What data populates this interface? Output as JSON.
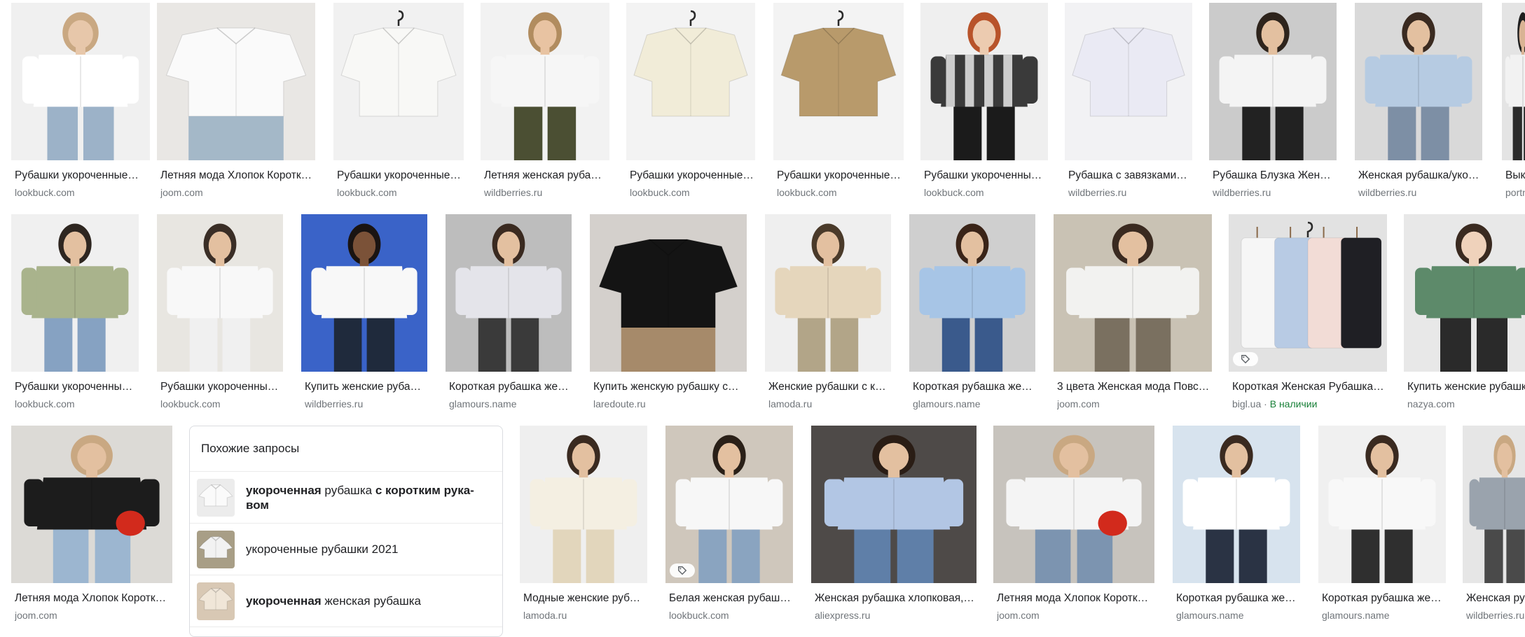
{
  "rows": [
    [
      {
        "title": "Рубашки укороченные…",
        "source": "lookbuck.com",
        "scene": {
          "bg": "#f0f0f0",
          "figure": true,
          "shirt": "#ffffff",
          "pants": "#9cb2c8",
          "hair": "#c9a882",
          "skin": "#e7c7aa"
        }
      },
      {
        "title": "Летняя мода Хлопок Короткий…",
        "source": "joom.com",
        "scene": {
          "bg": "#e9e7e4",
          "figure": false,
          "shirt": "#fafafa",
          "pants": "#a4b8c8",
          "skin": "#e0b898"
        }
      },
      {
        "title": "Рубашки укороченные…",
        "source": "lookbuck.com",
        "scene": {
          "bg": "#f1f1f1",
          "figure": false,
          "shirt": "#f8f8f6",
          "hanger": true
        }
      },
      {
        "title": "Летняя женская рубашка…",
        "source": "wildberries.ru",
        "scene": {
          "bg": "#f2f2f2",
          "figure": true,
          "shirt": "#f6f6f6",
          "pants": "#4b4f33",
          "hair": "#b18c5f",
          "skin": "#e8c3a2"
        }
      },
      {
        "title": "Рубашки укороченные…",
        "source": "lookbuck.com",
        "scene": {
          "bg": "#f3f3f3",
          "figure": false,
          "shirt": "#f1ecd8",
          "hanger": true
        }
      },
      {
        "title": "Рубашки укороченные…",
        "source": "lookbuck.com",
        "scene": {
          "bg": "#f3f3f3",
          "figure": false,
          "shirt": "#b89a6b",
          "hanger": true
        }
      },
      {
        "title": "Рубашки укороченные…",
        "source": "lookbuck.com",
        "scene": {
          "bg": "#efefef",
          "figure": true,
          "shirt": "#3a3a3a",
          "shirt2": "#f3f3f3",
          "pants": "#1b1b1b",
          "hair": "#b8532a",
          "skin": "#eccbb0"
        }
      },
      {
        "title": "Рубашка с завязками…",
        "source": "wildberries.ru",
        "scene": {
          "bg": "#f2f2f4",
          "figure": false,
          "shirt": "#eaeaf4"
        }
      },
      {
        "title": "Рубашка Блузка Женская…",
        "source": "wildberries.ru",
        "scene": {
          "bg": "#cbcbcb",
          "figure": true,
          "shirt": "#f4f4f4",
          "pants": "#222222",
          "hair": "#2e241c",
          "skin": "#e3c0a0"
        }
      },
      {
        "title": "Женская рубашка/укороченная…",
        "source": "wildberries.ru",
        "scene": {
          "bg": "#d9d9d9",
          "figure": true,
          "shirt": "#b6cbe2",
          "pants": "#7d8fa5",
          "hair": "#3a2a20",
          "skin": "#e3c0a0"
        }
      },
      {
        "title": "Выкройка…",
        "source": "portnoff.ru",
        "scene": {
          "bg": "#e4e4e4",
          "figure": true,
          "shirt": "#f2f2f2",
          "pants": "#2b2b2b",
          "hair": "#1f1f1f",
          "skin": "#d9b394"
        }
      }
    ],
    [
      {
        "title": "Рубашки укороченные…",
        "source": "lookbuck.com",
        "scene": {
          "bg": "#f0f0f0",
          "figure": true,
          "shirt": "#a9b38c",
          "pants": "#86a2c2",
          "hair": "#2e2620",
          "skin": "#e3c0a0"
        }
      },
      {
        "title": "Рубашки укороченные…",
        "source": "lookbuck.com",
        "scene": {
          "bg": "#e8e6e1",
          "figure": true,
          "shirt": "#f8f8f8",
          "pants": "#f0f0f0",
          "hair": "#3a2e26",
          "skin": "#e3c0a0"
        }
      },
      {
        "title": "Купить женские рубашки…",
        "source": "wildberries.ru",
        "scene": {
          "bg": "#3a63c8",
          "figure": true,
          "shirt": "#f8f8f8",
          "pants": "#1f2a3c",
          "hair": "#1a1412",
          "skin": "#7b5238"
        }
      },
      {
        "title": "Короткая рубашка женская…",
        "source": "glamours.name",
        "scene": {
          "bg": "#bdbdbd",
          "figure": true,
          "shirt": "#e4e4ea",
          "pants": "#3a3a3a",
          "hair": "#3a2a20",
          "skin": "#e3c0a0"
        }
      },
      {
        "title": "Купить женскую рубашку с…",
        "source": "laredoute.ru",
        "scene": {
          "bg": "#d4d0cc",
          "figure": false,
          "shirt": "#141414",
          "pants": "#a68a6a",
          "skin": "#e3c0a0"
        }
      },
      {
        "title": "Женские рубашки с коротким…",
        "source": "lamoda.ru",
        "scene": {
          "bg": "#efefef",
          "figure": true,
          "shirt": "#e5d6bc",
          "pants": "#b2a588",
          "hair": "#4a3a2a",
          "skin": "#e3c0a0"
        }
      },
      {
        "title": "Короткая рубашка женская…",
        "source": "glamours.name",
        "scene": {
          "bg": "#cfcfcf",
          "figure": true,
          "shirt": "#a7c5e6",
          "pants": "#3a5a8c",
          "hair": "#3a2418",
          "skin": "#e3c0a0"
        }
      },
      {
        "title": "3 цвета Женская мода Повседневная…",
        "source": "joom.com",
        "scene": {
          "bg": "#c9c2b4",
          "figure": true,
          "shirt": "#f2f2f0",
          "pants": "#7a7060",
          "hair": "#3a2a20",
          "skin": "#e3c0a0"
        }
      },
      {
        "title": "Короткая Женская Рубашка…",
        "source": "bigl.ua",
        "stock": "В наличии",
        "tag": true,
        "scene": {
          "bg": "#e2e2e2",
          "figure": false,
          "shirt": "#f6f6f6",
          "extra": [
            "#b8cbe4",
            "#f2dcd6",
            "#1f1f24"
          ],
          "hanger": true
        }
      },
      {
        "title": "Купить женские рубашки…",
        "source": "nazya.com",
        "scene": {
          "bg": "#e8e8e8",
          "figure": true,
          "shirt": "#5d8a6a",
          "pants": "#2a2a2a",
          "hair": "#3a2a20",
          "skin": "#efd2bb"
        }
      }
    ],
    [
      {
        "title": "Летняя мода Хлопок Короткий…",
        "source": "joom.com",
        "scene": {
          "bg": "#dcdad6",
          "figure": true,
          "shirt": "#1c1c1c",
          "pants": "#9cb6d0",
          "hair": "#c9a882",
          "skin": "#e3c0a0",
          "bag": "#d22a1c"
        }
      },
      {
        "title": "Модные женские рубашки…",
        "source": "lamoda.ru",
        "scene": {
          "bg": "#efefef",
          "figure": true,
          "shirt": "#f4efe2",
          "pants": "#e2d6bc",
          "hair": "#3a2a20",
          "skin": "#e3c0a0"
        }
      },
      {
        "title": "Белая женская рубашка…",
        "source": "lookbuck.com",
        "tag": true,
        "scene": {
          "bg": "#cfc7bc",
          "figure": true,
          "shirt": "#f7f7f7",
          "pants": "#8aa4c0",
          "hair": "#2a2018",
          "skin": "#e3c0a0"
        }
      },
      {
        "title": "Женская рубашка хлопковая,…",
        "source": "aliexpress.ru",
        "scene": {
          "bg": "#4e4a48",
          "figure": true,
          "shirt": "#b2c6e4",
          "pants": "#5f7fa8",
          "hair": "#2a1d15",
          "skin": "#e3c0a0"
        }
      },
      {
        "title": "Летняя мода Хлопок Короткий…",
        "source": "joom.com",
        "scene": {
          "bg": "#c7c3bd",
          "figure": true,
          "shirt": "#f4f4f4",
          "pants": "#7c94b0",
          "hair": "#c9a882",
          "skin": "#e3c0a0",
          "bag": "#d22a1c"
        }
      },
      {
        "title": "Короткая рубашка женская…",
        "source": "glamours.name",
        "scene": {
          "bg": "#d7e3ee",
          "figure": true,
          "shirt": "#ffffff",
          "pants": "#2a3344",
          "hair": "#3a2a20",
          "skin": "#e3c0a0"
        }
      },
      {
        "title": "Короткая рубашка женская…",
        "source": "glamours.name",
        "scene": {
          "bg": "#f0f0f0",
          "figure": true,
          "shirt": "#f8f8f8",
          "pants": "#2f2f2f",
          "hair": "#3a2a20",
          "skin": "#e3c0a0"
        }
      },
      {
        "title": "Женская рубашка…",
        "source": "wildberries.ru",
        "scene": {
          "bg": "#e6e6e6",
          "figure": true,
          "shirt": "#9aa3ad",
          "pants": "#4a4a4a",
          "hair": "#c9a882",
          "skin": "#e3c0a0"
        }
      }
    ]
  ],
  "related": {
    "heading": "Похожие запросы",
    "items": [
      {
        "parts": [
          [
            "b",
            "укороченная"
          ],
          [
            "n",
            " рубашка "
          ],
          [
            "b",
            "с коротким рука-"
          ]
        ],
        "line2": [
          [
            "b",
            "вом"
          ]
        ],
        "thumb": {
          "bg": "#ececec",
          "shirt": "#fafafa"
        }
      },
      {
        "parts": [
          [
            "n",
            "укороченные рубашки 2021"
          ]
        ],
        "line2": [],
        "thumb": {
          "bg": "#a89e86",
          "shirt": "#f2f2f2"
        }
      },
      {
        "parts": [
          [
            "b",
            "укороченная"
          ],
          [
            "n",
            " женская рубашка"
          ]
        ],
        "line2": [],
        "thumb": {
          "bg": "#d8c8b4",
          "shirt": "#f0e6d8"
        }
      }
    ]
  },
  "icons": {
    "tag": "price-tag-icon"
  }
}
